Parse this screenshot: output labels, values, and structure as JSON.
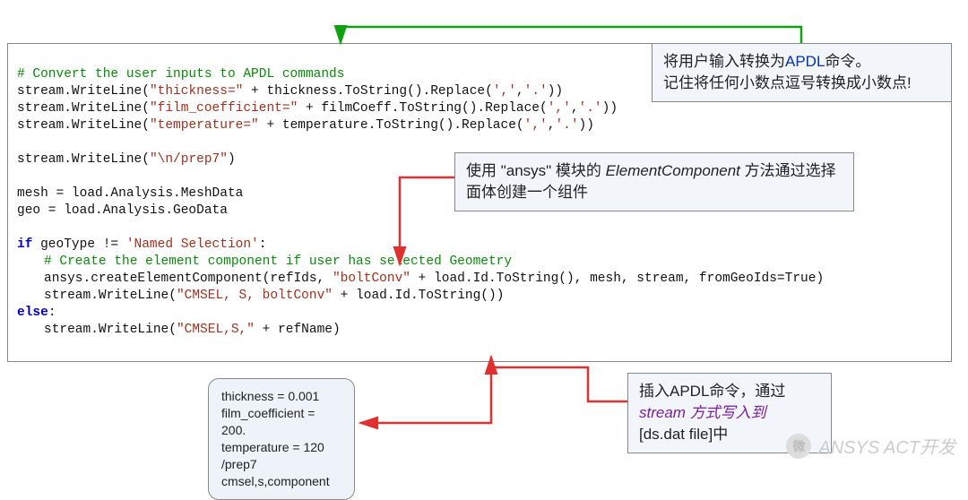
{
  "code": {
    "l1_comment": "# Convert the user inputs to APDL commands",
    "l2_a": "stream.WriteLine(",
    "l2_s": "\"thickness=\"",
    "l2_b": " + thickness.ToString().Replace(",
    "l2_s2": "','",
    "l2_c": ",",
    "l2_s3": "'.'",
    "l2_d": "))",
    "l3_a": "stream.WriteLine(",
    "l3_s": "\"film_coefficient=\"",
    "l3_b": " + filmCoeff.ToString().Replace(",
    "l3_s2": "','",
    "l3_c": ",",
    "l3_s3": "'.'",
    "l3_d": "))",
    "l4_a": "stream.WriteLine(",
    "l4_s": "\"temperature=\"",
    "l4_b": " + temperature.ToString().Replace(",
    "l4_s2": "','",
    "l4_c": ",",
    "l4_s3": "'.'",
    "l4_d": "))",
    "l6_a": "stream.WriteLine(",
    "l6_s": "\"\\n/prep7\"",
    "l6_b": ")",
    "l8": "mesh = load.Analysis.MeshData",
    "l9": "geo = load.Analysis.GeoData",
    "l11_if": "if",
    "l11_body": " geoType != ",
    "l11_s": "'Named Selection'",
    "l11_colon": ":",
    "l12_comment": "# Create the element component if user has selected Geometry",
    "l13_a": "ansys.createElementComponent(refIds, ",
    "l13_s": "\"boltConv\"",
    "l13_b": " + load.Id.ToString(), mesh, stream, fromGeoIds=True)",
    "l14_a": "stream.WriteLine(",
    "l14_s": "\"CMSEL, S, boltConv\"",
    "l14_b": " + load.Id.ToString())",
    "l15_else": "else",
    "l15_colon": ":",
    "l16_a": "stream.WriteLine(",
    "l16_s": "\"CMSEL,S,\"",
    "l16_b": " + refName)"
  },
  "callouts": {
    "top_right_1": "将用户输入转换为",
    "top_right_apdl": "APDL",
    "top_right_2": "命令。",
    "top_right_3": "记住将任何小数点逗号转换成小数点!",
    "middle_1a": "使用 \"ansys\" 模块的 ",
    "middle_elem": "ElementComponent",
    "middle_1b": " 方法通过选择面体创建一个组件",
    "bottom_right_1": "插入APDL命令，通过",
    "bottom_right_stream": "stream ",
    "bottom_right_way": "方式写入到",
    "bottom_right_2": "[ds.dat file]中"
  },
  "values_box": {
    "l1": "thickness = 0.001",
    "l2": "film_coefficient = 200.",
    "l3": "temperature = 120",
    "l4": "/prep7",
    "l5": "cmsel,s,component"
  },
  "watermark": {
    "label": "ANSYS ACT开发",
    "icon": "微"
  }
}
